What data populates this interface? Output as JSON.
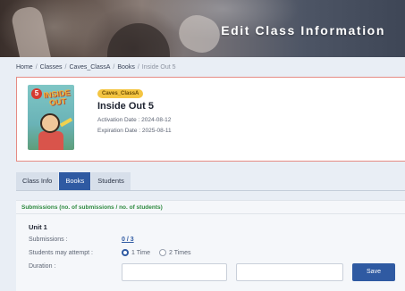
{
  "header": {
    "title": "Edit Class Information"
  },
  "breadcrumb": {
    "items": [
      "Home",
      "Classes",
      "Caves_ClassA",
      "Books",
      "Inside Out 5"
    ],
    "separator": "/"
  },
  "book": {
    "class_tag": "Caves_ClassA",
    "title": "Inside Out 5",
    "activation_date": "Activation Date : 2024-08-12",
    "expiration_date": "Expiration Date : 2025-08-11",
    "cover": {
      "number": "5",
      "title_line1": "INSIDE",
      "title_line2": "OUT"
    }
  },
  "tabs": [
    {
      "label": "Class Info",
      "active": false
    },
    {
      "label": "Books",
      "active": true
    },
    {
      "label": "Students",
      "active": false
    }
  ],
  "submissions": {
    "header": "Submissions (no. of submissions / no. of students)",
    "unit_title": "Unit 1",
    "submissions_label": "Submissions :",
    "submissions_value": "0 / 3",
    "attempt_label": "Students may attempt :",
    "attempt_options": [
      "1 Time",
      "2 Times"
    ],
    "attempt_selected": "1 Time",
    "duration_label": "Duration :",
    "save_label": "Save"
  },
  "colors": {
    "accent": "#2f5aa2",
    "card_border": "#e58b84",
    "tag": "#f4c542",
    "submissions_header": "#2e8a3f"
  }
}
